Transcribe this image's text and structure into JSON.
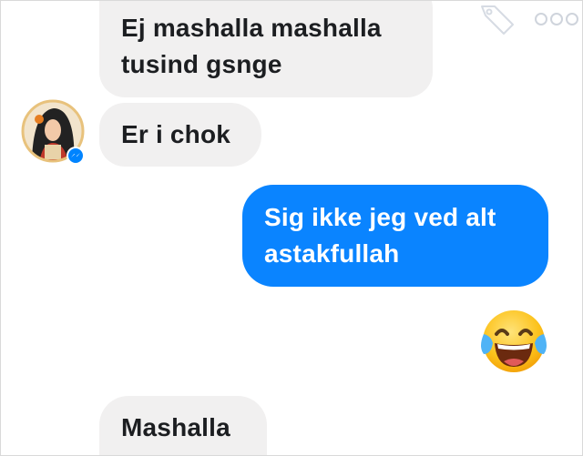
{
  "messages": [
    {
      "direction": "incoming",
      "lines": [
        "Ej mashalla mashalla",
        "tusind gsnge"
      ]
    },
    {
      "direction": "incoming",
      "lines": [
        "Er i chok"
      ]
    },
    {
      "direction": "outgoing",
      "lines": [
        "Sig ikke jeg ved alt",
        "astakfullah"
      ]
    },
    {
      "direction": "incoming",
      "lines": [
        "Mashalla"
      ]
    }
  ],
  "reaction": {
    "type": "emoji",
    "icon": "face-with-tears-of-joy-icon"
  },
  "sender_avatar": {
    "icon": "avatar",
    "badge": "messenger-badge-icon"
  },
  "header_icons": [
    "tag-icon",
    "more-options-icon"
  ],
  "colors": {
    "incoming_bubble": "#f1f0f0",
    "outgoing_bubble": "#0a84ff",
    "incoming_text": "#1c1e21",
    "outgoing_text": "#ffffff"
  }
}
